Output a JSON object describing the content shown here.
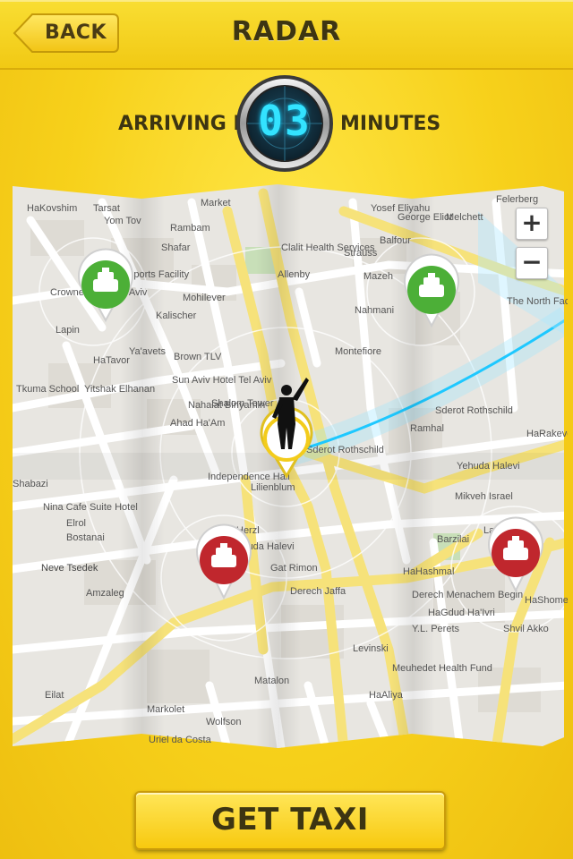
{
  "header": {
    "back_label": "BACK",
    "title": "RADAR"
  },
  "arrival": {
    "prefix": "ARRIVING IN:",
    "minutes": "03",
    "suffix": "MINUTES"
  },
  "map": {
    "zoom_in": "+",
    "zoom_out": "−",
    "labels": [
      "HaKovshim",
      "Market",
      "Tarsat",
      "Yom Tov",
      "Rambam",
      "Shafar",
      "Sports Facility",
      "Crowne Plaza Tel Aviv",
      "Lapin",
      "HaTavor",
      "Ya'avets",
      "Mohilever",
      "Kalischer",
      "Clalit Health Services",
      "Allenby",
      "Strauss",
      "Yosef Eliyahu",
      "George Eliot",
      "Balfour",
      "Melchett",
      "Mazeh",
      "Nahmani",
      "Montefiore",
      "Brown TLV",
      "Sun Aviv Hotel Tel Aviv",
      "Shalom Tower",
      "Ahad Ha'Am",
      "Yitshak Elhanan",
      "Tkuma School",
      "Sderot Rothschild",
      "Independence Hall",
      "Lilienblum",
      "Nahalat Binyamin",
      "Herzl",
      "Yehuda Halevi",
      "Gat Rimon",
      "Derech Jaffa",
      "Derech Menachem Begin",
      "HaShomer",
      "Neve Tsedek",
      "Amzaleg",
      "Shabazi",
      "Nina Cafe Suite Hotel",
      "Elrol",
      "Bostanai",
      "Mikveh Israel",
      "Lavontin",
      "Barzilai",
      "HaHashmal",
      "HaGdud Ha'Ivri",
      "Shvil Akko",
      "Y.L. Perets",
      "Levinski",
      "Wolfson",
      "Matalon",
      "Meuhedet Health Fund",
      "Eilat",
      "Markolet",
      "Ramhal",
      "HaRakevet",
      "Sderot Rothschild",
      "Yehuda Halevi",
      "The North Face Store",
      "Felerberg",
      "HaAliya",
      "Uriel da Costa"
    ]
  },
  "get_taxi_label": "GET TAXI",
  "colors": {
    "accent": "#f7d11b",
    "timer": "#33e3ff",
    "taxi_green": "#4caf37",
    "taxi_red": "#c0272d",
    "route": "#1ec8ff"
  }
}
